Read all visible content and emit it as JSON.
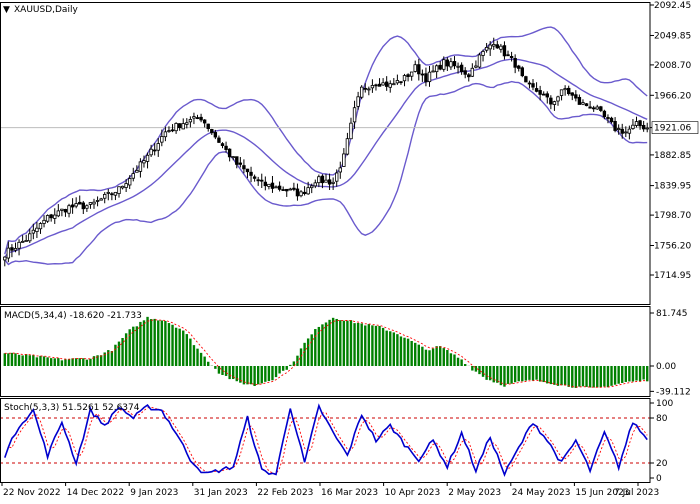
{
  "chart_data": [
    {
      "type": "candlestick",
      "title": "XAUUSD,Daily",
      "current_price": "1921.06",
      "y_ticks": [
        "2092.45",
        "2049.85",
        "2008.70",
        "1966.20",
        "1921.06",
        "1882.85",
        "1839.95",
        "1798.70",
        "1756.20",
        "1714.95"
      ],
      "ylim": [
        1714.95,
        2092.45
      ],
      "x_labels": [
        "22 Nov 2022",
        "14 Dec 2022",
        "9 Jan 2023",
        "31 Jan 2023",
        "22 Feb 2023",
        "16 Mar 2023",
        "10 Apr 2023",
        "2 May 2023",
        "24 May 2023",
        "15 Jun 2023",
        "7 Jul 2023"
      ],
      "bollinger_color": "#6a5acd",
      "anchors": [
        [
          0,
          1745
        ],
        [
          6,
          1765
        ],
        [
          12,
          1795
        ],
        [
          18,
          1810
        ],
        [
          24,
          1812
        ],
        [
          32,
          1835
        ],
        [
          40,
          1880
        ],
        [
          45,
          1915
        ],
        [
          50,
          1928
        ],
        [
          55,
          1935
        ],
        [
          60,
          1902
        ],
        [
          65,
          1870
        ],
        [
          72,
          1842
        ],
        [
          78,
          1835
        ],
        [
          83,
          1828
        ],
        [
          87,
          1848
        ],
        [
          92,
          1845
        ],
        [
          95,
          1880
        ],
        [
          98,
          1945
        ],
        [
          100,
          1975
        ],
        [
          104,
          1985
        ],
        [
          108,
          1980
        ],
        [
          112,
          1990
        ],
        [
          115,
          2005
        ],
        [
          118,
          1990
        ],
        [
          123,
          2012
        ],
        [
          127,
          2005
        ],
        [
          130,
          1995
        ],
        [
          133,
          2020
        ],
        [
          137,
          2042
        ],
        [
          140,
          2025
        ],
        [
          143,
          2010
        ],
        [
          146,
          1980
        ],
        [
          150,
          1970
        ],
        [
          153,
          1955
        ],
        [
          157,
          1975
        ],
        [
          161,
          1955
        ],
        [
          165,
          1950
        ],
        [
          168,
          1935
        ],
        [
          171,
          1920
        ],
        [
          174,
          1915
        ],
        [
          177,
          1925
        ],
        [
          180,
          1921
        ]
      ]
    },
    {
      "type": "bar",
      "title": "MACD(5,34,4) -18.620 -21.733",
      "y_ticks": [
        "81.745",
        "0.00",
        "-39.112"
      ],
      "ylim": [
        -39.112,
        81.745
      ],
      "bar_color": "#008000",
      "signal_color": "#ff0000",
      "anchors": [
        [
          0,
          20
        ],
        [
          8,
          15
        ],
        [
          16,
          10
        ],
        [
          24,
          12
        ],
        [
          30,
          25
        ],
        [
          35,
          55
        ],
        [
          40,
          75
        ],
        [
          45,
          70
        ],
        [
          50,
          55
        ],
        [
          55,
          20
        ],
        [
          60,
          -10
        ],
        [
          65,
          -25
        ],
        [
          70,
          -30
        ],
        [
          75,
          -20
        ],
        [
          80,
          0
        ],
        [
          84,
          35
        ],
        [
          88,
          62
        ],
        [
          92,
          75
        ],
        [
          96,
          70
        ],
        [
          100,
          65
        ],
        [
          105,
          60
        ],
        [
          110,
          50
        ],
        [
          115,
          35
        ],
        [
          118,
          25
        ],
        [
          122,
          30
        ],
        [
          125,
          20
        ],
        [
          128,
          10
        ],
        [
          131,
          -5
        ],
        [
          135,
          -20
        ],
        [
          140,
          -30
        ],
        [
          144,
          -25
        ],
        [
          148,
          -22
        ],
        [
          152,
          -25
        ],
        [
          156,
          -30
        ],
        [
          160,
          -32
        ],
        [
          165,
          -35
        ],
        [
          170,
          -30
        ],
        [
          174,
          -25
        ],
        [
          180,
          -21.7
        ]
      ]
    },
    {
      "type": "line",
      "title": "Stoch(5,3,3) 51.5261 52.6374",
      "y_ticks": [
        "100",
        "80",
        "20",
        "0"
      ],
      "ylim": [
        0,
        100
      ],
      "levels": [
        80,
        20
      ],
      "series": [
        {
          "color": "#0000cd"
        },
        {
          "color": "#ff0000"
        }
      ],
      "anchors": [
        [
          0,
          30
        ],
        [
          4,
          70
        ],
        [
          8,
          90
        ],
        [
          12,
          30
        ],
        [
          16,
          75
        ],
        [
          20,
          20
        ],
        [
          24,
          90
        ],
        [
          28,
          70
        ],
        [
          32,
          95
        ],
        [
          36,
          80
        ],
        [
          40,
          95
        ],
        [
          44,
          90
        ],
        [
          48,
          60
        ],
        [
          52,
          25
        ],
        [
          56,
          5
        ],
        [
          60,
          10
        ],
        [
          64,
          15
        ],
        [
          68,
          80
        ],
        [
          72,
          10
        ],
        [
          76,
          5
        ],
        [
          80,
          95
        ],
        [
          84,
          20
        ],
        [
          88,
          95
        ],
        [
          92,
          60
        ],
        [
          96,
          30
        ],
        [
          100,
          85
        ],
        [
          104,
          50
        ],
        [
          108,
          70
        ],
        [
          112,
          45
        ],
        [
          116,
          25
        ],
        [
          120,
          50
        ],
        [
          124,
          15
        ],
        [
          128,
          60
        ],
        [
          132,
          10
        ],
        [
          136,
          55
        ],
        [
          140,
          5
        ],
        [
          144,
          40
        ],
        [
          148,
          75
        ],
        [
          152,
          50
        ],
        [
          156,
          20
        ],
        [
          160,
          50
        ],
        [
          164,
          10
        ],
        [
          168,
          60
        ],
        [
          172,
          15
        ],
        [
          176,
          75
        ],
        [
          180,
          51.5
        ]
      ]
    }
  ]
}
